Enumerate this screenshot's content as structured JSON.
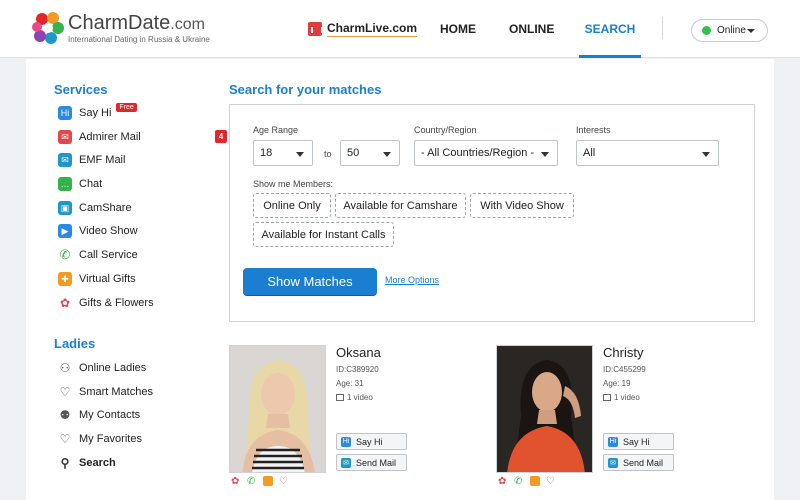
{
  "header": {
    "brand_name": "CharmDate",
    "brand_suffix": ".com",
    "brand_tagline": "International Dating in Russia & Ukraine",
    "charmlive": "CharmLive.com",
    "nav": {
      "home": "HOME",
      "online": "ONLINE",
      "search": "SEARCH"
    },
    "status": "Online"
  },
  "sidebar": {
    "services_title": "Services",
    "services": [
      {
        "label": "Say Hi",
        "icon": "say-hi-icon",
        "badge": "Free"
      },
      {
        "label": "Admirer Mail",
        "icon": "admirer-mail-icon",
        "count": "4"
      },
      {
        "label": "EMF Mail",
        "icon": "emf-mail-icon"
      },
      {
        "label": "Chat",
        "icon": "chat-icon"
      },
      {
        "label": "CamShare",
        "icon": "camshare-icon"
      },
      {
        "label": "Video Show",
        "icon": "video-show-icon"
      },
      {
        "label": "Call Service",
        "icon": "call-icon"
      },
      {
        "label": "Virtual Gifts",
        "icon": "gift-icon"
      },
      {
        "label": "Gifts & Flowers",
        "icon": "flower-icon"
      }
    ],
    "ladies_title": "Ladies",
    "ladies": [
      {
        "label": "Online Ladies",
        "icon": "user-icon"
      },
      {
        "label": "Smart Matches",
        "icon": "heart-icon"
      },
      {
        "label": "My Contacts",
        "icon": "contacts-icon"
      },
      {
        "label": "My Favorites",
        "icon": "heart-outline-icon"
      },
      {
        "label": "Search",
        "icon": "search-icon"
      }
    ]
  },
  "search": {
    "title": "Search for your matches",
    "age_range_label": "Age Range",
    "age_from": "18",
    "to_label": "to",
    "age_to": "50",
    "country_label": "Country/Region",
    "country_value": "- All Countries/Region -",
    "interests_label": "Interests",
    "interests_value": "All",
    "show_me_label": "Show me Members:",
    "filters": [
      "Online Only",
      "Available for Camshare",
      "With Video Show",
      "Available for Instant Calls"
    ],
    "submit": "Show Matches",
    "more_options": "More Options"
  },
  "profiles": [
    {
      "name": "Oksana",
      "id": "ID:C389920",
      "age": "Age: 31",
      "video": "1 video",
      "say_hi": "Say Hi",
      "send_mail": "Send Mail"
    },
    {
      "name": "Christy",
      "id": "ID:C455299",
      "age": "Age: 19",
      "video": "1 video",
      "say_hi": "Say Hi",
      "send_mail": "Send Mail"
    }
  ],
  "colors": {
    "accent": "#1a7fd0",
    "badge": "#e4262b",
    "online": "#31c24b"
  }
}
